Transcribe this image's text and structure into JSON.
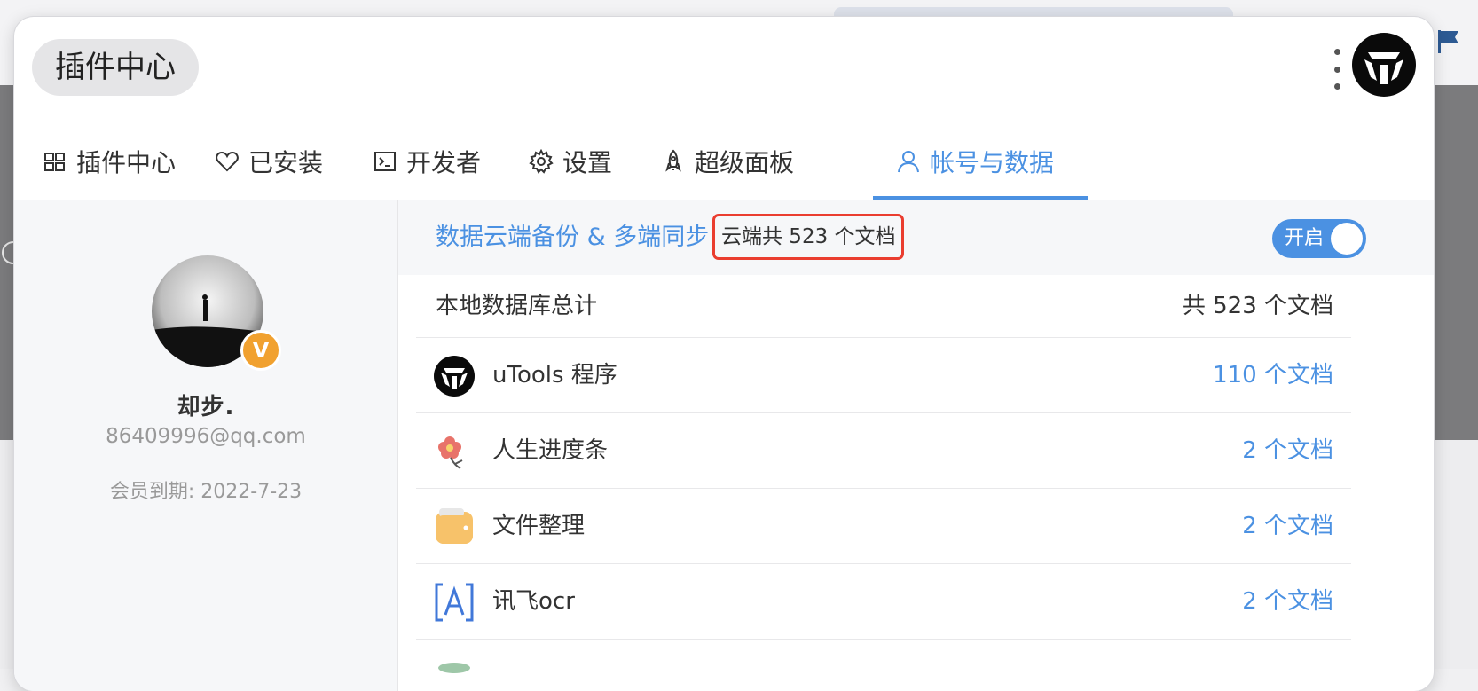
{
  "window": {
    "title": "插件中心"
  },
  "tabs": [
    {
      "label": "插件中心",
      "icon": "grid-icon"
    },
    {
      "label": "已安装",
      "icon": "heart-icon"
    },
    {
      "label": "开发者",
      "icon": "terminal-icon"
    },
    {
      "label": "设置",
      "icon": "gear-icon"
    },
    {
      "label": "超级面板",
      "icon": "rocket-icon"
    },
    {
      "label": "帐号与数据",
      "icon": "user-icon",
      "active": true
    }
  ],
  "profile": {
    "vip_badge": "V",
    "username": "却步.",
    "email": "86409996@qq.com",
    "membership": "会员到期: 2022-7-23"
  },
  "sync": {
    "title": "数据云端备份 & 多端同步",
    "cloud_count": "云端共 523 个文档",
    "toggle_label": "开启",
    "enabled": true
  },
  "local": {
    "label": "本地数据库总计",
    "total": "共 523 个文档"
  },
  "plugins": [
    {
      "name": "uTools 程序",
      "count": "110 个文档",
      "icon": "utools-logo-icon"
    },
    {
      "name": "人生进度条",
      "count": "2 个文档",
      "icon": "flower-icon"
    },
    {
      "name": "文件整理",
      "count": "2 个文档",
      "icon": "folder-icon"
    },
    {
      "name": "讯飞ocr",
      "count": "2 个文档",
      "icon": "ocr-icon"
    }
  ],
  "colors": {
    "accent": "#4b91e2",
    "highlight": "#ea3d2f",
    "badge": "#f1a12f"
  }
}
